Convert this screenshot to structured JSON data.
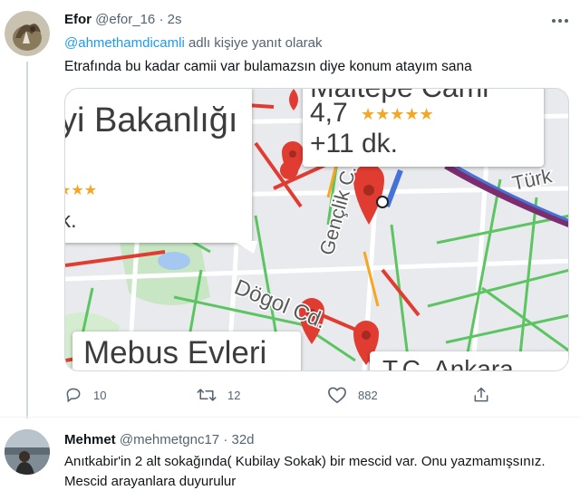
{
  "tweet": {
    "author_name": "Efor",
    "author_handle": "@efor_16",
    "time": "2s",
    "reply_to_handle": "@ahmethamdicamli",
    "reply_to_suffix": " adlı kişiye yanıt olarak",
    "text": "Etrafında bu kadar camii var bulamazsın diye konum atayım sana",
    "media": {
      "callout_left_title": "yi Bakanlığı",
      "callout_left_rating_frag": "★★★",
      "callout_left_frag": "k.",
      "callout_top_name": "Maltepe Cami",
      "callout_top_rating": "4,7",
      "callout_top_stars": "★★★★★",
      "callout_top_time": "+11 dk.",
      "callout_bottom_left": "Mebus Evleri",
      "callout_bottom_right": "T.C. Ankara",
      "street_genclik": "Gençlik C.",
      "street_dogol": "Dögol Cd.",
      "street_turk": "Türk",
      "colors": {
        "traffic_red": "#e03c31",
        "traffic_green": "#5cc461",
        "traffic_amber": "#f5a623",
        "route_blue": "#4472d9",
        "route_purple": "#7b2d6e"
      }
    },
    "actions": {
      "reply_count": "10",
      "retweet_count": "12",
      "like_count": "882",
      "share_icon": "share-icon"
    }
  },
  "reply": {
    "author_name": "Mehmet",
    "author_handle": "@mehmetgnc17",
    "time": "32d",
    "text": "Anıtkabir'in 2 alt sokağında( Kubilay Sokak) bir mescid var. Onu yazmamışsınız. Mescid arayanlara duyurulur"
  }
}
